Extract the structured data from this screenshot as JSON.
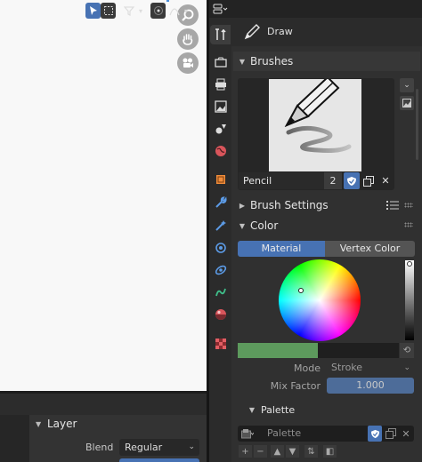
{
  "properties": {
    "tool_name": "Draw",
    "brushes_panel": {
      "title": "Brushes",
      "brush_name": "Pencil",
      "users_count": "2"
    },
    "brush_settings_title": "Brush Settings",
    "color_panel": {
      "title": "Color",
      "tab_material": "Material",
      "tab_vertex_color": "Vertex Color",
      "swatch_color": "#5d9a5d",
      "mode_label": "Mode",
      "mode_value": "Stroke",
      "mix_factor_label": "Mix Factor",
      "mix_factor_value": "1.000"
    },
    "palette_panel": {
      "title": "Palette",
      "placeholder": "Palette"
    }
  },
  "layer_panel": {
    "title": "Layer",
    "blend_label": "Blend",
    "blend_value": "Regular"
  },
  "accent_color": "#4772b3"
}
